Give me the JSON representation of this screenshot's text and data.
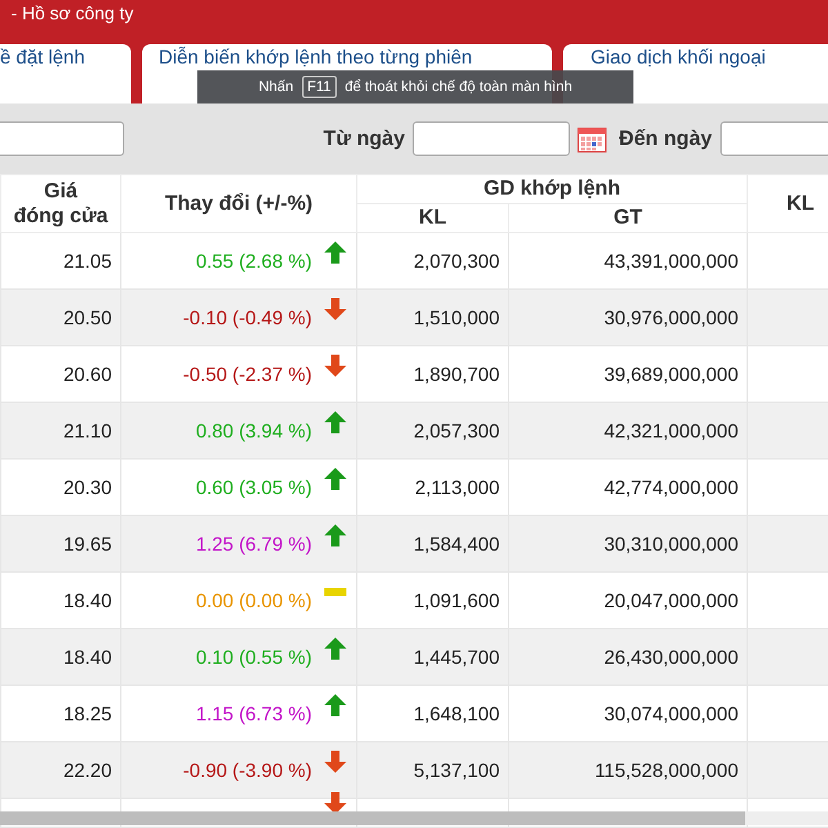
{
  "header": {
    "title": "- Hồ sơ công ty"
  },
  "tabs": [
    {
      "label": "ề đặt lệnh",
      "selected": false
    },
    {
      "label": "Diễn biến khớp lệnh theo từng phiên",
      "selected": false
    },
    {
      "label": "Giao dịch khối ngoại",
      "selected": false
    }
  ],
  "fullscreen_notice": {
    "before": "Nhấn",
    "key": "F11",
    "after": "để thoát khỏi chế độ toàn màn hình"
  },
  "filter": {
    "from_label": "Từ ngày",
    "to_label": "Đến ngày"
  },
  "table": {
    "columns": {
      "close": "Giá\nđóng cửa",
      "change": "Thay đổi (+/-%)",
      "group": "GD khớp lệnh",
      "kl": "KL",
      "gt": "GT",
      "column_6": "KL"
    },
    "rows": [
      {
        "close": "21.05",
        "change": "0.55 (2.68 %)",
        "kind": "up",
        "kl": "2,070,300",
        "gt": "43,391,000,000"
      },
      {
        "close": "20.50",
        "change": "-0.10 (-0.49 %)",
        "kind": "down",
        "kl": "1,510,000",
        "gt": "30,976,000,000"
      },
      {
        "close": "20.60",
        "change": "-0.50 (-2.37 %)",
        "kind": "down",
        "kl": "1,890,700",
        "gt": "39,689,000,000"
      },
      {
        "close": "21.10",
        "change": "0.80 (3.94 %)",
        "kind": "up",
        "kl": "2,057,300",
        "gt": "42,321,000,000"
      },
      {
        "close": "20.30",
        "change": "0.60 (3.05 %)",
        "kind": "up",
        "kl": "2,113,000",
        "gt": "42,774,000,000"
      },
      {
        "close": "19.65",
        "change": "1.25 (6.79 %)",
        "kind": "ceiling",
        "kl": "1,584,400",
        "gt": "30,310,000,000"
      },
      {
        "close": "18.40",
        "change": "0.00 (0.00 %)",
        "kind": "flat",
        "kl": "1,091,600",
        "gt": "20,047,000,000"
      },
      {
        "close": "18.40",
        "change": "0.10 (0.55 %)",
        "kind": "up",
        "kl": "1,445,700",
        "gt": "26,430,000,000"
      },
      {
        "close": "18.25",
        "change": "1.15 (6.73 %)",
        "kind": "ceiling",
        "kl": "1,648,100",
        "gt": "30,074,000,000"
      },
      {
        "close": "22.20",
        "change": "-0.90 (-3.90 %)",
        "kind": "down",
        "kl": "5,137,100",
        "gt": "115,528,000,000"
      },
      {
        "kind": "down"
      }
    ]
  }
}
